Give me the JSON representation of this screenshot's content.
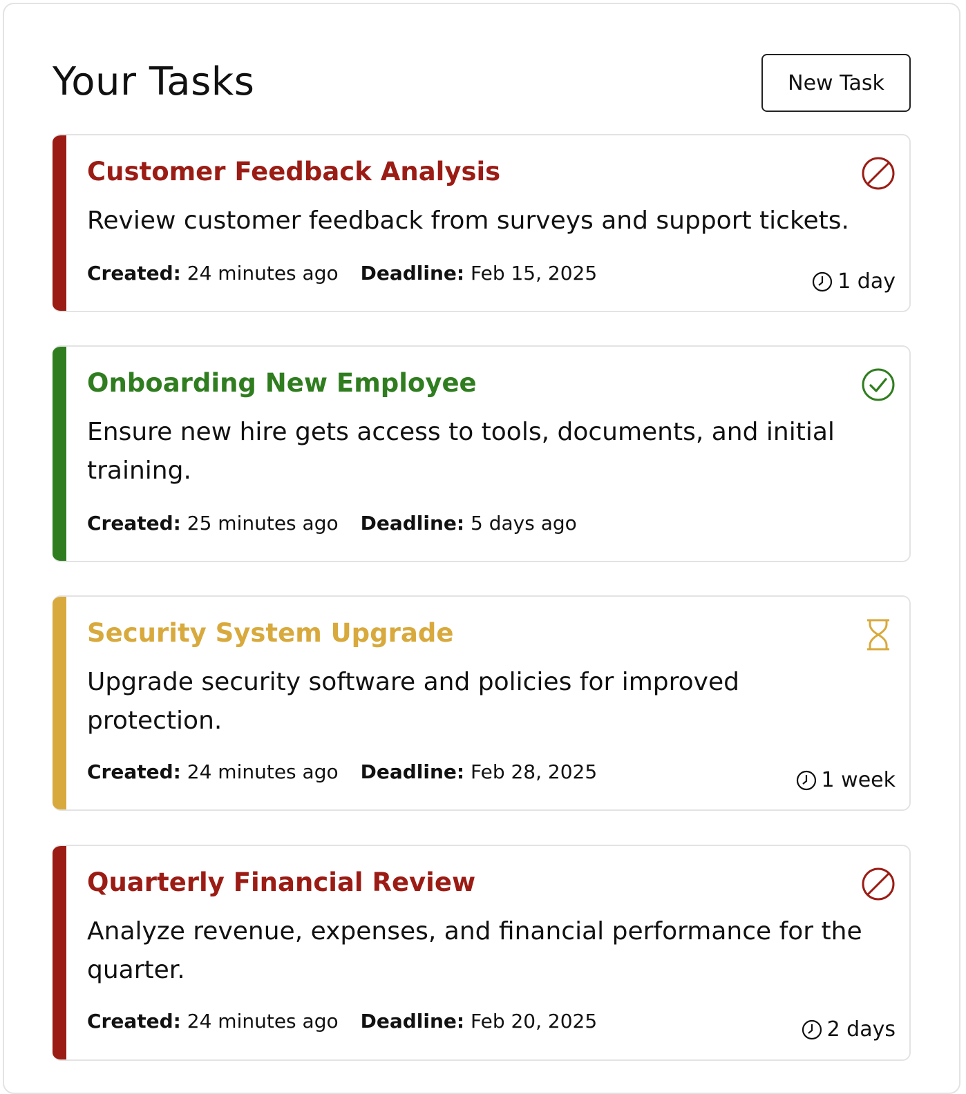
{
  "header": {
    "title": "Your Tasks",
    "new_task_label": "New Task"
  },
  "labels": {
    "created": "Created:",
    "deadline": "Deadline:"
  },
  "colors": {
    "overdue": "#9b1c14",
    "done": "#2f7d1f",
    "pending": "#d8a93c"
  },
  "tasks": [
    {
      "title": "Customer Feedback Analysis",
      "description": "Review customer feedback from surveys and support tickets.",
      "created": "24 minutes ago",
      "deadline": "Feb 15, 2025",
      "time_left": "1 day",
      "status": "overdue",
      "status_icon": "blocked-icon"
    },
    {
      "title": "Onboarding New Employee",
      "description": "Ensure new hire gets access to tools, documents, and initial training.",
      "created": "25 minutes ago",
      "deadline": "5 days ago",
      "time_left": "",
      "status": "done",
      "status_icon": "check-circle-icon"
    },
    {
      "title": "Security System Upgrade",
      "description": "Upgrade security software and policies for improved protection.",
      "created": "24 minutes ago",
      "deadline": "Feb 28, 2025",
      "time_left": "1 week",
      "status": "pending",
      "status_icon": "hourglass-icon"
    },
    {
      "title": "Quarterly Financial Review",
      "description": "Analyze revenue, expenses, and financial performance for the quarter.",
      "created": "24 minutes ago",
      "deadline": "Feb 20, 2025",
      "time_left": "2 days",
      "status": "overdue",
      "status_icon": "blocked-icon"
    }
  ]
}
